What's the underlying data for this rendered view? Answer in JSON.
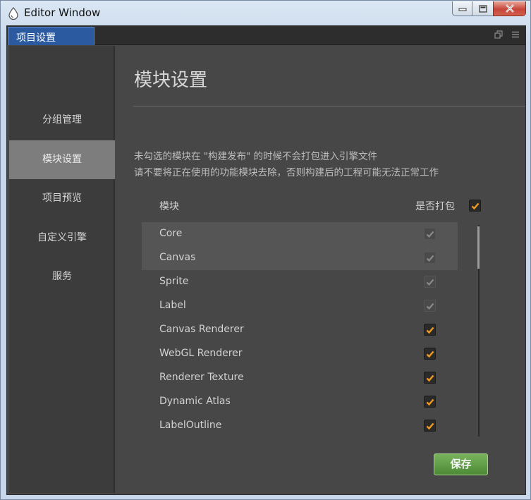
{
  "window": {
    "title": "Editor Window",
    "icon": "drop-icon"
  },
  "tabs": [
    {
      "label": "项目设置",
      "active": true
    }
  ],
  "sidebar": {
    "items": [
      {
        "label": "分组管理",
        "active": false
      },
      {
        "label": "模块设置",
        "active": true
      },
      {
        "label": "项目预览",
        "active": false
      },
      {
        "label": "自定义引擎",
        "active": false
      },
      {
        "label": "服务",
        "active": false
      }
    ]
  },
  "main": {
    "title": "模块设置",
    "description_line1": "未勾选的模块在 \"构建发布\" 的时候不会打包进入引擎文件",
    "description_line2": "请不要将正在使用的功能模块去除，否则构建后的工程可能无法正常工作",
    "header_module": "模块",
    "header_pack": "是否打包",
    "header_pack_checked": true,
    "modules": [
      {
        "name": "Core",
        "checked": true,
        "locked": true
      },
      {
        "name": "Canvas",
        "checked": true,
        "locked": true
      },
      {
        "name": "Sprite",
        "checked": true,
        "locked": true
      },
      {
        "name": "Label",
        "checked": true,
        "locked": true
      },
      {
        "name": "Canvas Renderer",
        "checked": true,
        "locked": false
      },
      {
        "name": "WebGL Renderer",
        "checked": true,
        "locked": false
      },
      {
        "name": "Renderer Texture",
        "checked": true,
        "locked": false
      },
      {
        "name": "Dynamic Atlas",
        "checked": true,
        "locked": false
      },
      {
        "name": "LabelOutline",
        "checked": true,
        "locked": false
      }
    ],
    "save_label": "保存"
  },
  "colors": {
    "accent_check": "#f29a1f",
    "tab_active": "#2b5aa0",
    "save_button": "#5f9d45"
  }
}
